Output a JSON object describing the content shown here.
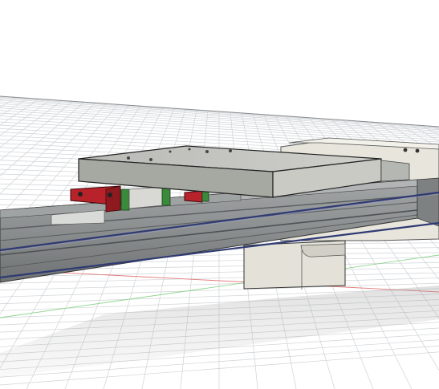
{
  "viewport": {
    "background": "#ffffff",
    "grid_color": "#c9ccd0",
    "x_axis_color": "#e06a6a",
    "y_axis_color": "#7fcf7f"
  },
  "model": {
    "rail_color": "#8e9293",
    "rail_dark": "#4a4d4f",
    "plate_color": "#c3c4bf",
    "plate_side": "#8f918b",
    "carriage_red": "#b8222a",
    "carriage_green": "#3b8a3b",
    "support_color": "#e6e4da",
    "belt_color": "#2f3a73"
  }
}
